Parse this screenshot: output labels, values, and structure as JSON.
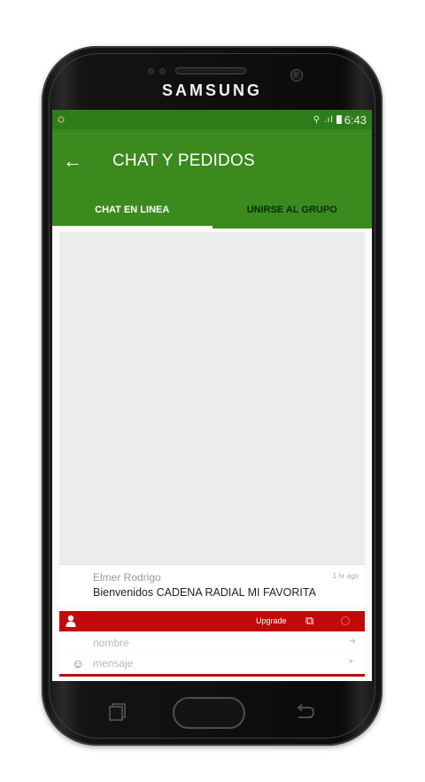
{
  "phone": {
    "brand": "SAMSUNG"
  },
  "statusbar": {
    "time": "6:43",
    "icons": "⚲ .ıl"
  },
  "appbar": {
    "title": "CHAT Y PEDIDOS",
    "back_icon": "arrow-left-icon"
  },
  "tabs": [
    {
      "label": "CHAT EN LINEA",
      "active": true
    },
    {
      "label": "UNIRSE AL GRUPO",
      "active": false
    }
  ],
  "messages": [
    {
      "author": "Elmer Rodrigo",
      "time": "1 hr ago",
      "text": "Bienvenidos CADENA RADIAL MI FAVORITA"
    }
  ],
  "toolbar": {
    "upgrade_label": "Upgrade"
  },
  "inputs": {
    "name_placeholder": "nombre",
    "message_placeholder": "mensaje"
  },
  "colors": {
    "appbar": "#3b8a1e",
    "statusbar": "#2e7d1b",
    "chat_bar": "#c30a0a",
    "chat_bg": "#ececec"
  }
}
